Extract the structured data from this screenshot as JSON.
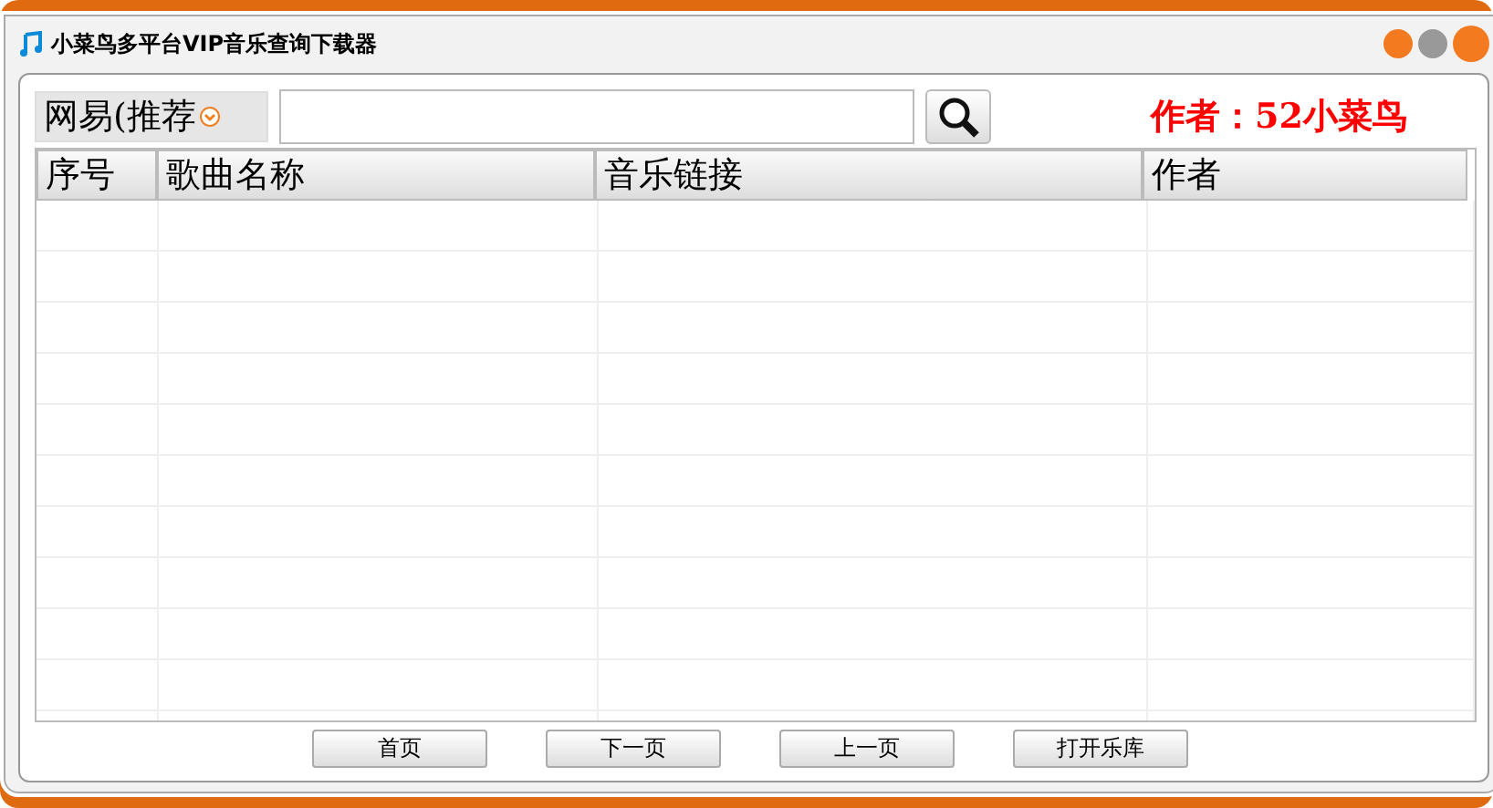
{
  "window": {
    "title": "小菜鸟多平台VIP音乐查询下载器"
  },
  "toolbar": {
    "source": "网易(推荐",
    "author_label": "作者：52小菜鸟"
  },
  "table": {
    "columns": [
      "序号",
      "歌曲名称",
      "音乐链接",
      "作者"
    ]
  },
  "buttons": [
    "首页",
    "下一页",
    "上一页",
    "打开乐库"
  ]
}
